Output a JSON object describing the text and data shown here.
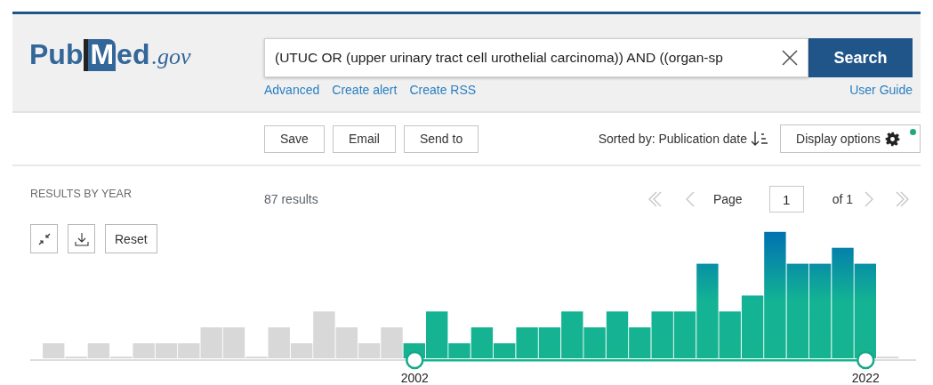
{
  "logo": {
    "brand": "Pub",
    "initial": "M",
    "rest": "ed",
    "domain": ".gov"
  },
  "search": {
    "value": "(UTUC OR (upper urinary tract cell urothelial carcinoma)) AND ((organ-sp",
    "button": "Search"
  },
  "search_links": [
    "Advanced",
    "Create alert",
    "Create RSS"
  ],
  "user_guide": "User Guide",
  "actions": [
    "Save",
    "Email",
    "Send to"
  ],
  "sort": "Sorted by: Publication date",
  "display_options": {
    "label": "Display options",
    "indicator": true
  },
  "results": {
    "heading": "RESULTS BY YEAR",
    "count": "87 results",
    "reset": "Reset"
  },
  "pagination": {
    "page_label": "Page",
    "page": "1",
    "of": "of 1"
  },
  "timeline": {
    "start": "2002",
    "end": "2022"
  }
}
